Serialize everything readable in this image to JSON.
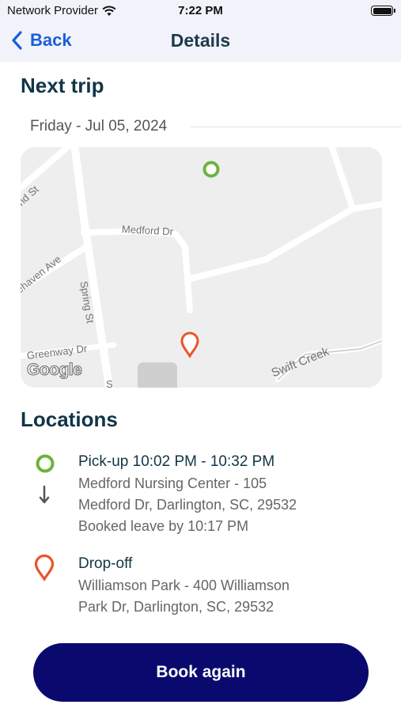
{
  "status": {
    "carrier": "Network Provider",
    "time": "7:22 PM",
    "wifi_icon": "wifi-icon",
    "battery_icon": "battery-icon"
  },
  "nav": {
    "back_label": "Back",
    "back_icon": "chevron-left-icon",
    "title": "Details"
  },
  "trip": {
    "heading": "Next trip",
    "date": "Friday - Jul 05, 2024"
  },
  "map": {
    "street_labels": [
      "nd St",
      "Medford Dr",
      "ehaven Ave",
      "Spring St",
      "Greenway Dr",
      "Swift Creek",
      "S"
    ],
    "attribution": "Google",
    "pickup_marker_icon": "green-circle-marker-icon",
    "dropoff_marker_icon": "orange-pin-marker-icon"
  },
  "locations": {
    "heading": "Locations",
    "pickup": {
      "title": "Pick-up 10:02 PM - 10:32 PM",
      "address_line1": "Medford Nursing Center - 105",
      "address_line2": "Medford Dr, Darlington, SC, 29532",
      "note": "Booked leave by 10:17 PM",
      "icon": "green-circle-icon"
    },
    "arrow_icon": "arrow-down-icon",
    "dropoff": {
      "title": "Drop-off",
      "address_line1": "Williamson Park - 400 Williamson",
      "address_line2": "Park Dr, Darlington, SC, 29532",
      "icon": "map-pin-icon"
    }
  },
  "actions": {
    "book_again": "Book again"
  },
  "colors": {
    "brand_navy": "#0a0a6e",
    "back_blue": "#1a5fd8",
    "pickup_green": "#6db33f",
    "dropoff_orange": "#e8552a"
  }
}
